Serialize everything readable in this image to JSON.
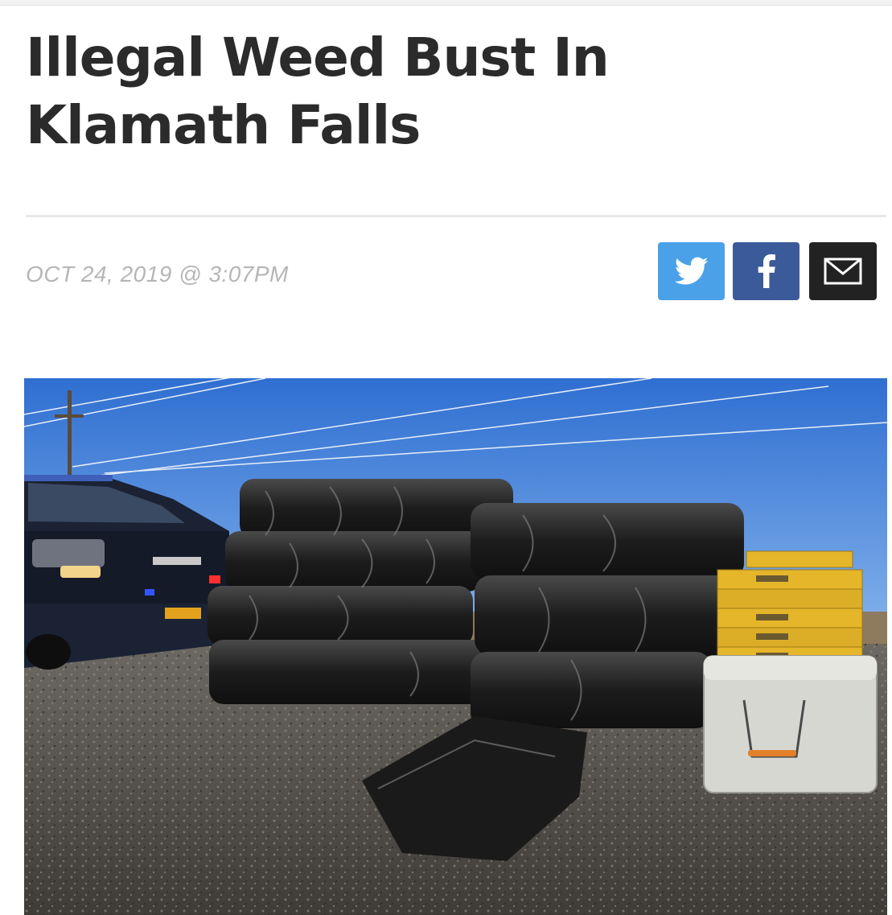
{
  "article": {
    "headline": "Illegal Weed Bust In Klamath Falls",
    "dateline": "OCT 24, 2019 @ 3:07PM"
  },
  "share": {
    "twitter_icon": "twitter-bird-icon",
    "facebook_icon": "facebook-f-icon",
    "email_icon": "envelope-icon"
  },
  "colors": {
    "twitter": "#4aa1e8",
    "facebook": "#3b5a9a",
    "email": "#222222",
    "headline": "#2b2b2b",
    "dateline": "#b6b6b6"
  }
}
